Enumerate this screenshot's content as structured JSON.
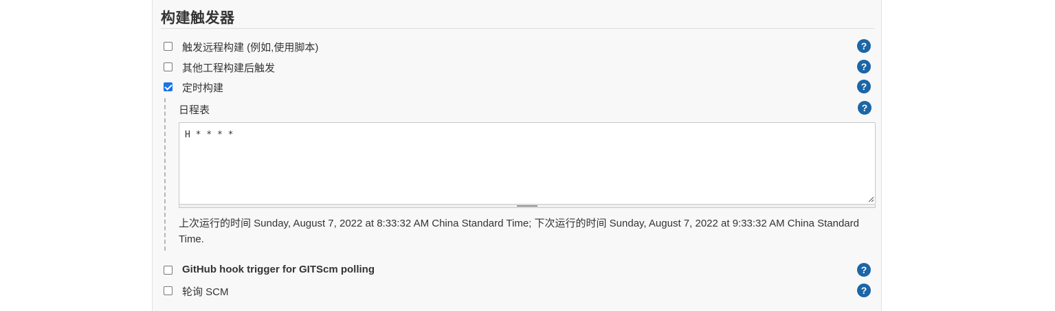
{
  "section": {
    "title": "构建触发器"
  },
  "triggers": [
    {
      "label": "触发远程构建 (例如,使用脚本)",
      "checked": false
    },
    {
      "label": "其他工程构建后触发",
      "checked": false
    },
    {
      "label": "定时构建",
      "checked": true
    },
    {
      "label": "GitHub hook trigger for GITScm polling",
      "checked": false
    },
    {
      "label": "轮询 SCM",
      "checked": false
    }
  ],
  "schedule": {
    "label": "日程表",
    "value": "H * * * *",
    "info": "上次运行的时间 Sunday, August 7, 2022 at 8:33:32 AM China Standard Time; 下次运行的时间 Sunday, August 7, 2022 at 9:33:32 AM China Standard Time."
  },
  "help": {
    "glyph": "?",
    "color": "#1b66a7"
  },
  "colors": {
    "checkbox_checked": "#1a73e8",
    "panel_background": "#f8f8f8"
  }
}
